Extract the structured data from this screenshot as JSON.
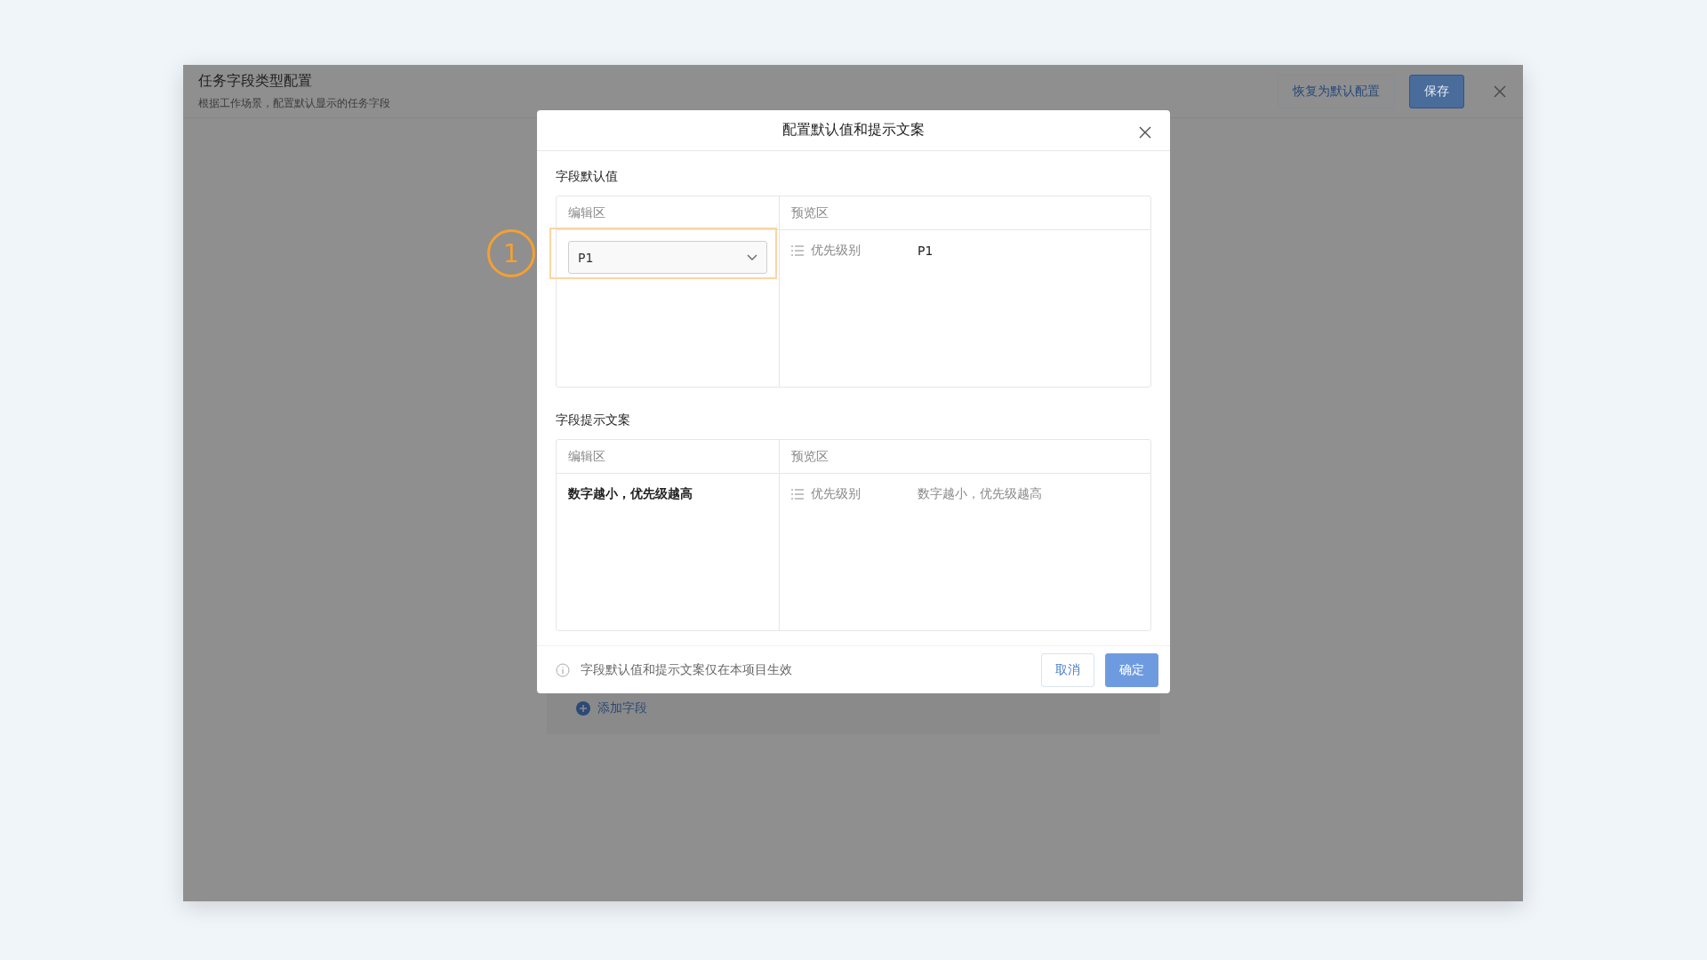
{
  "window": {
    "title": "任务字段类型配置",
    "subtitle": "根据工作场景，配置默认显示的任务字段",
    "buttons": [
      {
        "label": "恢复为默认配置",
        "kind": "secondary"
      },
      {
        "label": "保存",
        "kind": "primary"
      }
    ],
    "add_field": "添加字段"
  },
  "dialog": {
    "title": "配置默认值和提示文案",
    "sections": [
      {
        "title": "字段默认值",
        "kind": "select",
        "edit_header": "编辑区",
        "preview_header": "预览区",
        "edit_value": "P1",
        "preview_label": "优先级别",
        "preview_value": "P1",
        "annotation": "1"
      },
      {
        "title": "字段提示文案",
        "kind": "text",
        "edit_header": "编辑区",
        "preview_header": "预览区",
        "edit_value": "数字越小，优先级越高",
        "preview_label": "优先级别",
        "preview_value": "数字越小，优先级越高"
      }
    ],
    "note": "字段默认值和提示文案仅在本项目生效",
    "buttons": [
      {
        "label": "取消",
        "kind": "secondary"
      },
      {
        "label": "确定",
        "kind": "primary"
      }
    ]
  }
}
